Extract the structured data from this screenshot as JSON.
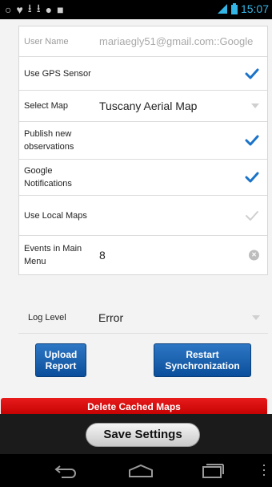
{
  "status_bar": {
    "time": "15:07",
    "left_icons": [
      "ring-icon",
      "location-icon",
      "download-icon",
      "download-icon",
      "gamepad-icon",
      "bag-icon"
    ],
    "accent": "#33b5e5"
  },
  "settings": {
    "user_name": {
      "label": "User Name",
      "value": "mariaegly51@gmail.com::Google"
    },
    "use_gps": {
      "label": "Use GPS Sensor",
      "checked": true
    },
    "select_map": {
      "label": "Select Map",
      "value": "Tuscany Aerial Map"
    },
    "publish_obs": {
      "label": "Publish new observations",
      "checked": true
    },
    "google_notif": {
      "label": "Google Notifications",
      "checked": true
    },
    "use_local_maps": {
      "label": "Use Local Maps",
      "checked": false
    },
    "events_menu": {
      "label": "Events in Main Menu",
      "value": "8"
    },
    "log_level": {
      "label": "Log Level",
      "value": "Error"
    }
  },
  "buttons": {
    "upload_report": "Upload Report",
    "restart_sync": "Restart Synchronization",
    "delete_cached_maps": "Delete Cached Maps",
    "save_settings": "Save Settings"
  },
  "colors": {
    "check_active": "#1a73c9",
    "check_inactive": "#cfcfcf",
    "primary_button": "#0b4f9c",
    "danger_button": "#d30a0a"
  }
}
